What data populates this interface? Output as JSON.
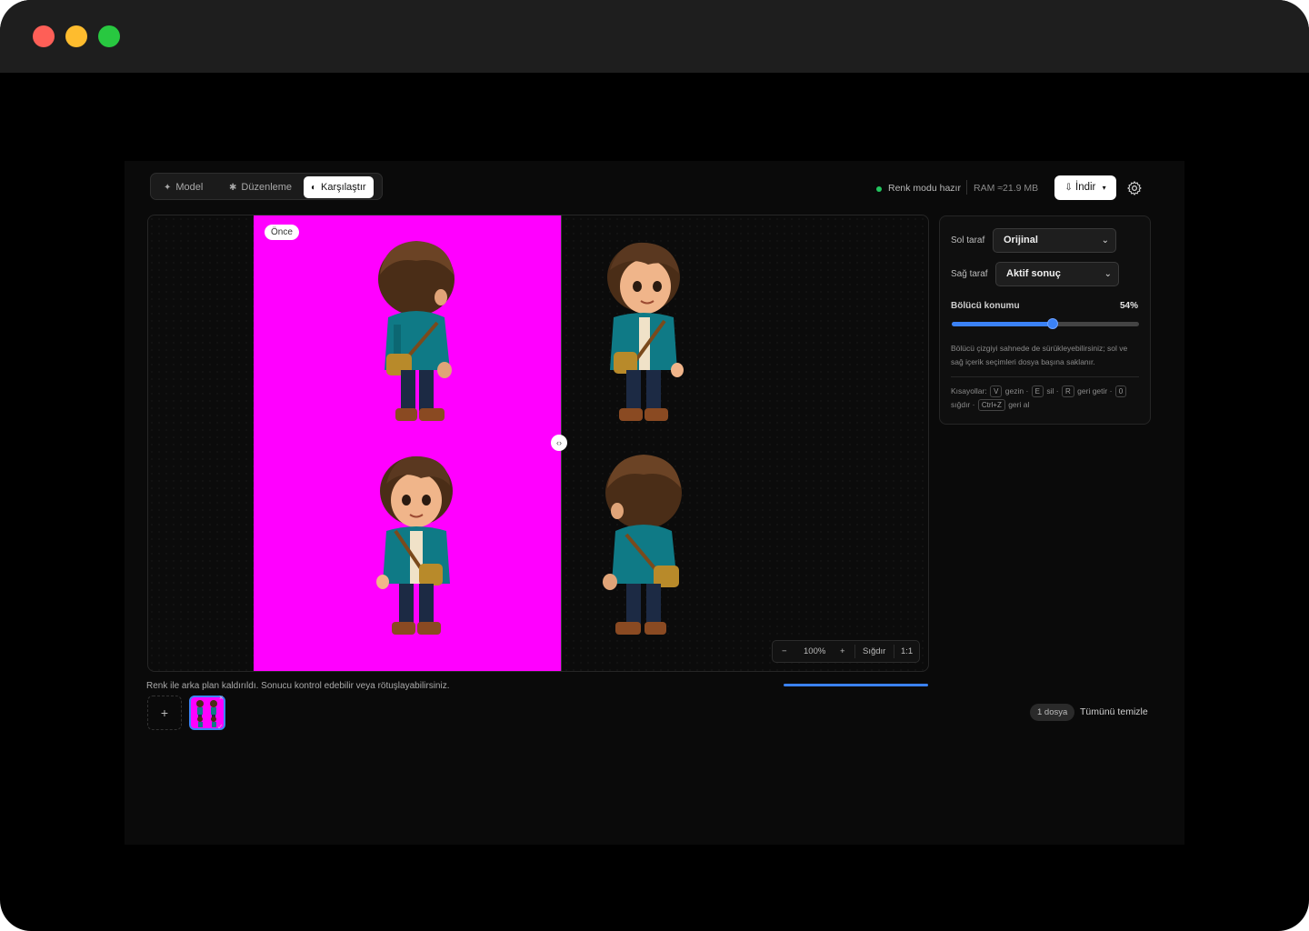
{
  "tabs": [
    {
      "icon": "✦",
      "label": "Model"
    },
    {
      "icon": "✱",
      "label": "Düzenleme"
    },
    {
      "icon": "◐",
      "label": "Karşılaştır"
    }
  ],
  "active_tab": "Karşılaştır",
  "header": {
    "status": "Renk modu hazır",
    "ram": "RAM ≈21.9 MB",
    "download_label": "İndir",
    "download_icon": "⇩",
    "download_caret": "▾"
  },
  "canvas": {
    "before_badge": "Önce",
    "background_color": "#ff00ff",
    "split_handle_glyph": "‹›",
    "zoom": {
      "minus": "−",
      "level": "100%",
      "plus": "+",
      "fit": "Sığdır",
      "actual": "1:1"
    }
  },
  "panel": {
    "left_label": "Sol taraf",
    "left_value": "Orijinal",
    "right_label": "Sağ taraf",
    "right_value": "Aktif sonuç",
    "divider_label": "Bölücü konumu",
    "divider_value": "54%",
    "divider_fraction": 0.54,
    "hint": "Bölücü çizgiyi sahnede de sürükleyebilirsiniz; sol ve sağ içerik seçimleri dosya başına saklanır.",
    "shortcuts": {
      "prefix": "Kısayollar:",
      "k1": "V",
      "t1": "gezin ·",
      "k2": "E",
      "t2": "sil ·",
      "k3": "R",
      "t3": "geri getir ·",
      "k4": "0",
      "t4": "sığdır ·",
      "k5": "Ctrl+Z",
      "t5": "geri al"
    }
  },
  "footer": {
    "caption": "Renk ile arka plan kaldırıldı. Sonucu kontrol edebilir veya rötuşlayabilirsiniz.",
    "add_label": "+",
    "thumb_close": "×",
    "thumb_check": "✓",
    "files": "1 dosya",
    "clear_all": "Tümünü temizle"
  },
  "colors": {
    "accent": "#3b82f6",
    "status_ok": "#22c55e",
    "magenta": "#ff00ff"
  }
}
